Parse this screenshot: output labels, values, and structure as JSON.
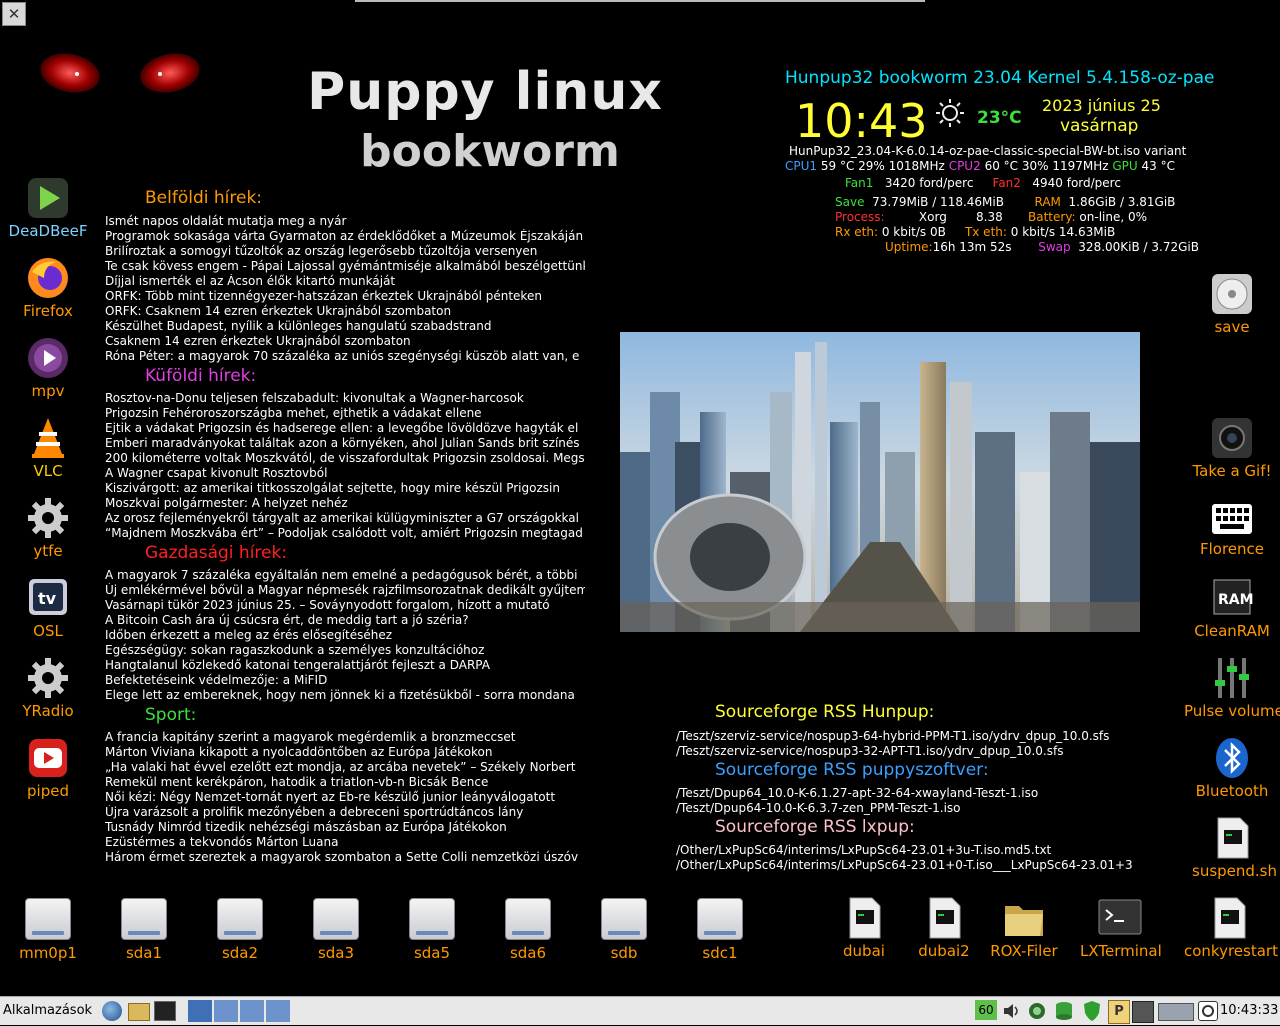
{
  "window": {
    "close_glyph": "✕"
  },
  "header": {
    "title": "Puppy linux",
    "subtitle": "bookworm"
  },
  "news": {
    "domestic": {
      "heading": "Belföldi hírek:",
      "color": "#ff9900",
      "items": [
        "Ismét napos oldalát mutatja meg a nyár",
        "Programok sokasága várta Gyarmaton az érdeklődőket a Múzeumok Éjszakáján",
        "Brilíroztak a somogyi tűzoltók az ország legerősebb tűzoltója versenyen",
        "Te csak kövess engem - Pápai Lajossal gyémántmiséje alkalmából beszélgettünk",
        "Díjjal ismerték el az Ácson élők kitartó munkáját",
        "ORFK: Több mint tizennégyezer-hatszázan érkeztek Ukrajnából pénteken",
        "ORFK: Csaknem 14 ezren érkeztek Ukrajnából szombaton",
        "Készülhet Budapest, nyílik a különleges hangulatú szabadstrand",
        "Csaknem 14 ezren érkeztek Ukrajnából szombaton",
        "Róna Péter: a magyarok 70 százaléka az uniós szegénységi küszöb alatt van, e"
      ]
    },
    "foreign": {
      "heading": "Küföldi hírek:",
      "color": "#e040e0",
      "items": [
        "Rosztov-na-Donu teljesen felszabadult: kivonultak a Wagner-harcosok",
        "Prigozsin Fehéroroszországba mehet, ejthetik a vádakat ellene",
        "Ejtik a vádakat Prigozsin és hadserege ellen: a levegőbe lövöldözve hagyták el",
        "Emberi maradványokat találtak azon a környéken, ahol Julian Sands brit színés",
        "200 kilométerre voltak Moszkvától, de visszafordultak Prigozsin zsoldosai. Megs",
        "A Wagner csapat kivonult Rosztovból",
        "Kiszivárgott: az amerikai titkosszolgálat sejtette, hogy mire készül Prigozsin",
        "Moszkvai polgármester: A helyzet nehéz",
        "Az orosz fejleményekről tárgyalt az amerikai külügyminiszter a G7 országokkal",
        "“Majdnem Moszkvába ért” – Podoljak csalódott volt, amiért Prigozsin megtagad"
      ]
    },
    "economy": {
      "heading": "Gazdasági hírek:",
      "color": "#ff2020",
      "items": [
        "A magyarok 7 százaléka egyáltalán nem emelné a pedagógusok bérét, a többi",
        "Új emlékérmével bővül a Magyar népmesék rajzfilmsorozatnak dedikált gyűjtemény",
        "Vasárnapi tükör 2023 június 25. – Sováynyodott forgalom, hízott a mutató",
        "A Bitcoin Cash ára új csúcsra ért, de meddig tart a jó széria?",
        "Időben érkezett a meleg az érés elősegítéséhez",
        "Egészségügy: sokan ragaszkodunk a személyes konzultációhoz",
        "Hangtalanul közlekedő katonai tengeralattjárót fejleszt a DARPA",
        "Befektetéseink védelmezője: a MiFID",
        "Elege lett az embereknek, hogy nem jönnek ki a fizetésükből - sorra mondana"
      ]
    },
    "sport": {
      "heading": "Sport:",
      "color": "#3ce03c",
      "items": [
        "A francia kapitány szerint a magyarok megérdemlik a bronzmeccset",
        "Márton Viviana kikapott a nyolcaddöntőben az Európa Játékokon",
        "„Ha valaki hat évvel ezelőtt ezt mondja, az arcába nevetek” – Székely Norbert",
        "Remekül ment kerékpáron, hatodik a triatlon-vb-n Bicsák Bence",
        "Női kézi: Négy Nemzet-tornát nyert az Eb-re készülő junior leányválogatott",
        "Újra varázsolt a prolifik mezőnyében a debreceni sportrúdtáncos lány",
        "Tusnády Nimród tizedik nehézségi mászásban az Európa Játékokon",
        "Ezüstérmes a tekvondós Márton Luana",
        "Három érmet szereztek a magyarok szombaton a Sette Colli nemzetközi úszóv"
      ]
    }
  },
  "conky": {
    "system_title": "Hunpup32 bookworm 23.04 Kernel 5.4.158-oz-pae",
    "time": "10:43",
    "weather_icon": "sun-icon",
    "temperature": "23°C",
    "date": "2023 június 25",
    "weekday": "vasárnap",
    "iso_name": "HunPup32_23.04-K-6.0.14-oz-pae-classic-special-BW-bt.iso variant",
    "cpu1_label": "CPU1",
    "cpu1_values": "59 °C  29%   1018MHz",
    "cpu2_label": "CPU2",
    "cpu2_values": "60 °C   30%   1197MHz",
    "gpu_label": "GPU",
    "gpu_values": "43 °C",
    "fan1_label": "Fan1",
    "fan1_value": "3420 ford/perc",
    "fan2_label": "Fan2",
    "fan2_value": "4940 ford/perc",
    "save_label": "Save",
    "save_value": "73.79MiB / 118.46MiB",
    "ram_label": "RAM",
    "ram_value": "1.86GiB / 3.81GiB",
    "process_label": "Process:",
    "process_value": "Xorg",
    "process_pct": "8.38",
    "battery_label": "Battery:",
    "battery_value": "on-line,   0%",
    "rx_label": "Rx eth:",
    "rx_value": "0 kbit/s      0B",
    "tx_label": "Tx eth:",
    "tx_value": "0 kbit/s    14.63MiB",
    "uptime_label": "Uptime:",
    "uptime_value": "16h 13m 52s",
    "swap_label": "Swap",
    "swap_value": "328.00KiB / 3.72GiB"
  },
  "rss": [
    {
      "title": "Sourceforge RSS Hunpup:",
      "color": "#ffff33",
      "lines": [
        "/Teszt/szerviz-service/nospup3-64-hybrid-PPM-T1.iso/ydrv_dpup_10.0.sfs",
        "/Teszt/szerviz-service/nospup3-32-APT-T1.iso/ydrv_dpup_10.0.sfs"
      ]
    },
    {
      "title": "Sourceforge RSS puppyszoftver:",
      "color": "#3aa0ff",
      "lines": [
        "/Teszt/Dpup64_10.0-K-6.1.27-apt-32-64-xwayland-Teszt-1.iso",
        "/Teszt/Dpup64-10.0-K-6.3.7-zen_PPM-Teszt-1.iso"
      ]
    },
    {
      "title": "Sourceforge RSS lxpup:",
      "color": "#ffc0cb",
      "lines": [
        "/Other/LxPupSc64/interims/LxPupSc64-23.01+3u-T.iso.md5.txt",
        "/Other/LxPupSc64/interims/LxPupSc64-23.01+0-T.iso___LxPupSc64-23.01+3"
      ]
    }
  ],
  "left_icons": [
    "DeaDBeeF",
    "Firefox",
    "mpv",
    "VLC",
    "ytfe",
    "OSL",
    "YRadio",
    "piped"
  ],
  "right_icons": [
    "save",
    "Take a Gif!",
    "Florence",
    "CleanRAM",
    "Pulse volume",
    "Bluetooth",
    "suspend.sh"
  ],
  "drives": [
    "mm0p1",
    "sda1",
    "sda2",
    "sda3",
    "sda5",
    "sda6",
    "sdb",
    "sdc1"
  ],
  "bottom_right_icons": [
    "dubai",
    "dubai2",
    "ROX-Filer",
    "LXTerminal",
    "conkyrestart"
  ],
  "taskbar": {
    "menu_label": "Alkalmazások",
    "tray_badge": "60",
    "clock": "10:43:33"
  },
  "colors": {
    "accent_cyan": "#00e5ff",
    "clock_yellow": "#ffff33",
    "temp_green": "#3ce03c",
    "taskbar_bg": "#e8e8e8"
  }
}
